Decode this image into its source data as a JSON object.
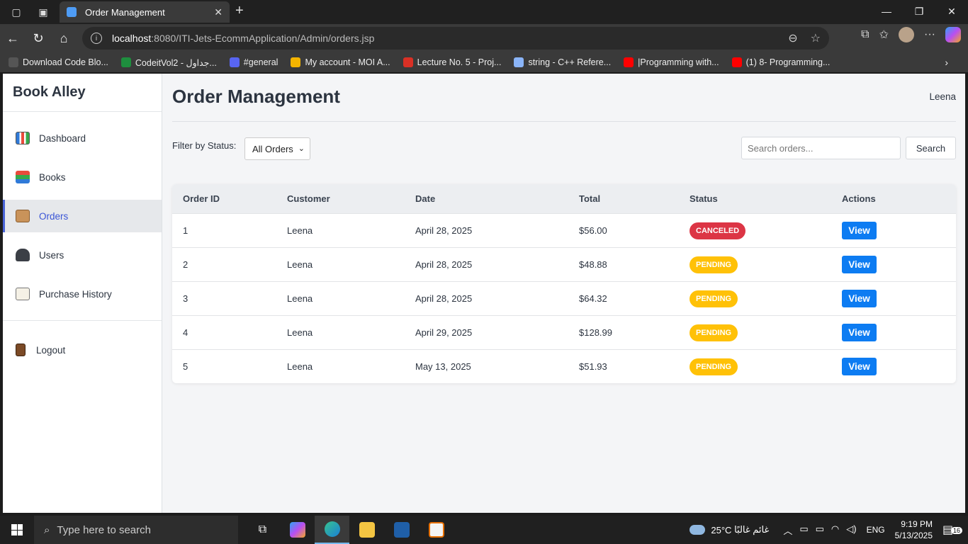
{
  "browser": {
    "tab_title": "Order Management",
    "url_host": "localhost",
    "url_rest": ":8080/ITI-Jets-EcommApplication/Admin/orders.jsp",
    "bookmarks": [
      {
        "label": "Download Code Blo...",
        "color": "#555555"
      },
      {
        "label": "CodeitVol2 - جداول...",
        "color": "#1e8e3e"
      },
      {
        "label": "#general",
        "color": "#5865f2"
      },
      {
        "label": "My account - MOI A...",
        "color": "#f4b400"
      },
      {
        "label": "Lecture No. 5 - Proj...",
        "color": "#d93025"
      },
      {
        "label": "string - C++ Refere...",
        "color": "#8ab4f8"
      },
      {
        "label": "|Programming with...",
        "color": "#ff0000"
      },
      {
        "label": "(1) 8- Programming...",
        "color": "#ff0000"
      }
    ]
  },
  "sidebar": {
    "brand": "Book Alley",
    "items": [
      {
        "label": "Dashboard",
        "icon": "bar-chart-icon"
      },
      {
        "label": "Books",
        "icon": "books-icon"
      },
      {
        "label": "Orders",
        "icon": "package-icon"
      },
      {
        "label": "Users",
        "icon": "users-icon"
      },
      {
        "label": "Purchase History",
        "icon": "memo-icon"
      }
    ],
    "logout": "Logout"
  },
  "header": {
    "title": "Order Management",
    "user": "Leena"
  },
  "filters": {
    "label": "Filter by Status:",
    "selected": "All Orders",
    "search_placeholder": "Search orders...",
    "search_button": "Search"
  },
  "table": {
    "columns": [
      "Order ID",
      "Customer",
      "Date",
      "Total",
      "Status",
      "Actions"
    ],
    "rows": [
      {
        "id": "1",
        "customer": "Leena",
        "date": "April 28, 2025",
        "total": "$56.00",
        "status": "CANCELED",
        "action": "View"
      },
      {
        "id": "2",
        "customer": "Leena",
        "date": "April 28, 2025",
        "total": "$48.88",
        "status": "PENDING",
        "action": "View"
      },
      {
        "id": "3",
        "customer": "Leena",
        "date": "April 28, 2025",
        "total": "$64.32",
        "status": "PENDING",
        "action": "View"
      },
      {
        "id": "4",
        "customer": "Leena",
        "date": "April 29, 2025",
        "total": "$128.99",
        "status": "PENDING",
        "action": "View"
      },
      {
        "id": "5",
        "customer": "Leena",
        "date": "May 13, 2025",
        "total": "$51.93",
        "status": "PENDING",
        "action": "View"
      }
    ]
  },
  "colors": {
    "canceled": "#dc3545",
    "pending": "#ffc107",
    "primary": "#0d7cf2",
    "active_nav": "#3a55d6"
  },
  "taskbar": {
    "search_placeholder": "Type here to search",
    "weather": "25°C",
    "weather_text": "غائم غالبًا",
    "lang": "ENG",
    "time": "9:19 PM",
    "date": "5/13/2025",
    "notifications": "16"
  }
}
